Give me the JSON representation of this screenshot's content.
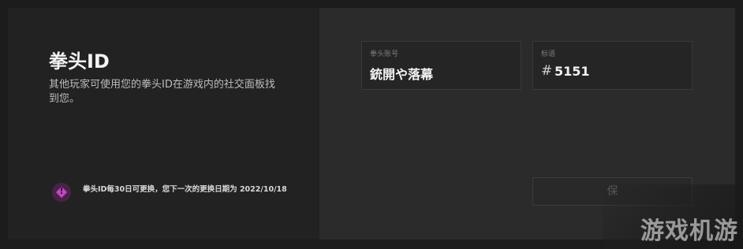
{
  "left": {
    "title": "拳头ID",
    "description": "其他玩家可使用您的拳头ID在游戏内的社交面板找到您。",
    "notice": {
      "icon": "alert-diamond-icon",
      "text": "拳头ID每30日可更换，您下一次的更换日期为 2022/10/18"
    }
  },
  "form": {
    "name_label": "拳头账号",
    "name_value": "銃開や落幕",
    "tag_label": "标语",
    "tag_prefix": "#",
    "tag_value": "5151",
    "save_label": "保"
  },
  "watermark": "游戏机游",
  "colors": {
    "background": "#1c1c1d",
    "left_panel": "#232223",
    "right_panel": "#2c2b2c",
    "notice_accent": "#c04ac0"
  }
}
